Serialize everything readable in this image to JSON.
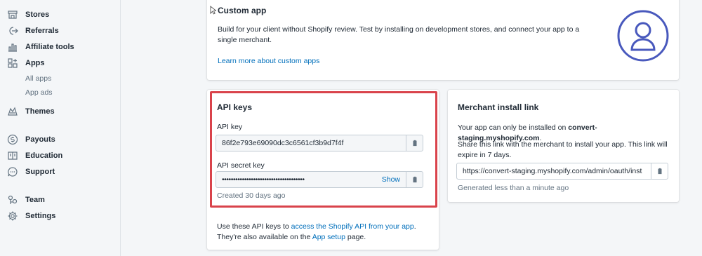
{
  "sidebar": {
    "items": [
      {
        "label": "Stores",
        "icon": "stores-icon"
      },
      {
        "label": "Referrals",
        "icon": "referrals-icon"
      },
      {
        "label": "Affiliate tools",
        "icon": "affiliate-tools-icon"
      },
      {
        "label": "Apps",
        "icon": "apps-icon"
      },
      {
        "label": "Themes",
        "icon": "themes-icon"
      },
      {
        "label": "Payouts",
        "icon": "payouts-icon"
      },
      {
        "label": "Education",
        "icon": "education-icon"
      },
      {
        "label": "Support",
        "icon": "support-icon"
      },
      {
        "label": "Team",
        "icon": "team-icon"
      },
      {
        "label": "Settings",
        "icon": "settings-icon"
      }
    ],
    "apps_sub": [
      "All apps",
      "App ads"
    ]
  },
  "custom_app": {
    "title": "Custom app",
    "description": "Build for your client without Shopify review. Test by installing on development stores, and connect your app to a single merchant.",
    "learn_more": "Learn more about custom apps"
  },
  "api_keys": {
    "title": "API keys",
    "api_key_label": "API key",
    "api_key_value": "86f2e793e69090dc3c6561cf3b9d7f4f",
    "secret_label": "API secret key",
    "secret_value": "•••••••••••••••••••••••••••••••••••••",
    "show_label": "Show",
    "created": "Created 30 days ago",
    "footer_prefix": "Use these API keys to ",
    "footer_link": "access the Shopify API from your app",
    "footer_suffix": ".",
    "footer2_prefix": "They're also available on the ",
    "footer2_link": "App setup",
    "footer2_suffix": " page."
  },
  "merchant": {
    "title": "Merchant install link",
    "line1_prefix": "Your app can only be installed on ",
    "line1_store": "convert-staging.myshopify.com",
    "line1_suffix": ".",
    "line2": "Share this link with the merchant to install your app. This link will expire in 7 days.",
    "link_value": "https://convert-staging.myshopify.com/admin/oauth/inst",
    "generated": "Generated less than a minute ago"
  },
  "colors": {
    "link": "#006fbb",
    "highlight": "#d9434b",
    "icon": "#4959bd"
  }
}
